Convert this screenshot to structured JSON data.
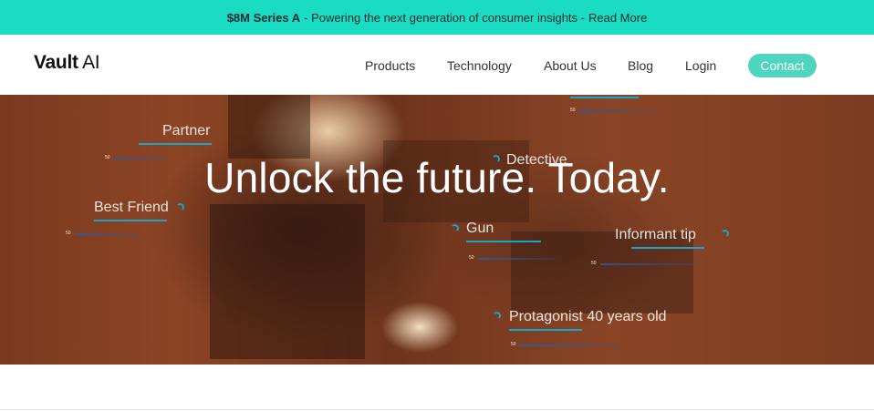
{
  "announcement": {
    "bold": "$8M Series A",
    "text": "- Powering the next generation of consumer insights -",
    "link": "Read More"
  },
  "nav": {
    "logo_bold": "Vault",
    "logo_light": "AI",
    "items": [
      "Products",
      "Technology",
      "About Us",
      "Blog",
      "Login"
    ],
    "cta": "Contact"
  },
  "hero": {
    "headline": "Unlock the future. Today.",
    "tags": [
      "Partner",
      "Detective",
      "Best Friend",
      "Gun",
      "Informant tip",
      "Protagonist 40 years old"
    ],
    "meter_label": "50"
  },
  "colors": {
    "announce_bg": "#19dcc3",
    "cta_bg": "#4fd4bf",
    "tag_accent": "#1aa5c8"
  }
}
